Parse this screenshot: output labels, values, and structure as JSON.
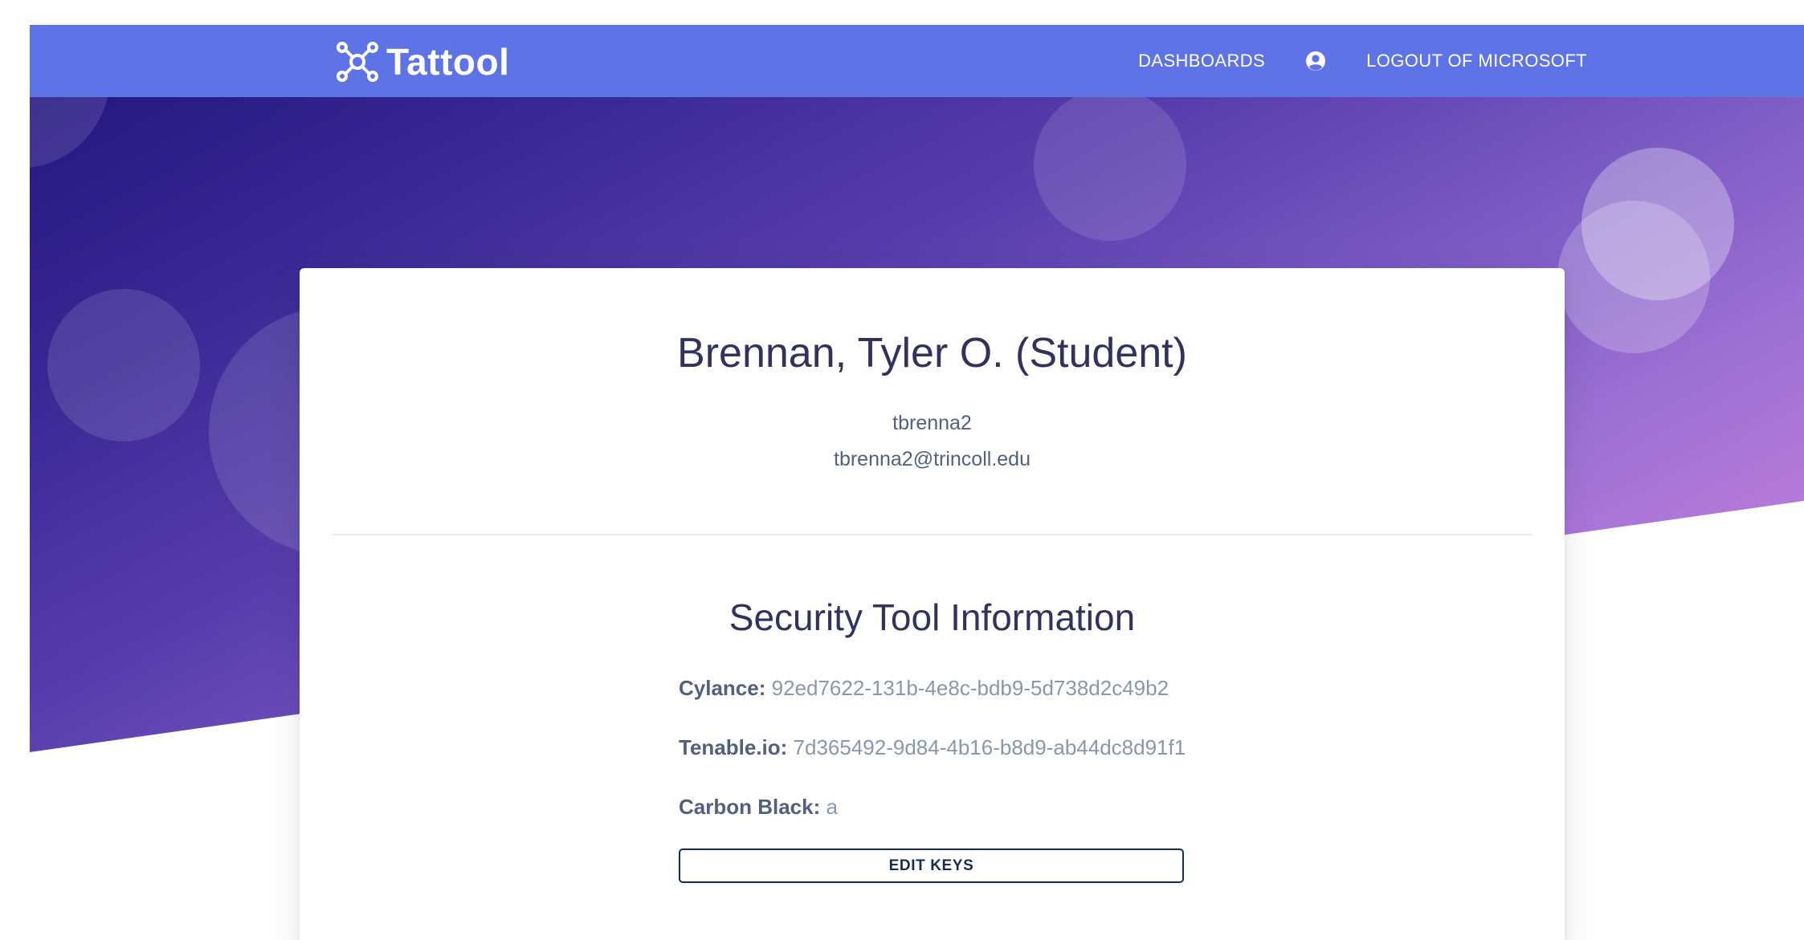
{
  "brand": {
    "name": "Tattool",
    "icon": "molecule-icon"
  },
  "nav": {
    "dashboards_label": "DASHBOARDS",
    "user_icon": "user-circle-icon",
    "logout_label": "LOGOUT OF MICROSOFT"
  },
  "profile": {
    "name": "Brennan, Tyler O. (Student)",
    "username": "tbrenna2",
    "email": "tbrenna2@trincoll.edu"
  },
  "security": {
    "title": "Security Tool Information",
    "keys": [
      {
        "label": "Cylance:",
        "value": "92ed7622-131b-4e8c-bdb9-5d738d2c49b2"
      },
      {
        "label": "Tenable.io:",
        "value": "7d365492-9d84-4b16-b8d9-ab44dc8d91f1"
      },
      {
        "label": "Carbon Black:",
        "value": "a"
      }
    ],
    "edit_button_label": "EDIT KEYS"
  },
  "colors": {
    "navbar": "#5e73e5",
    "gradient_start": "#251680",
    "gradient_end": "#d983d8",
    "heading_text": "#32325d",
    "button_border": "#172b4d"
  }
}
